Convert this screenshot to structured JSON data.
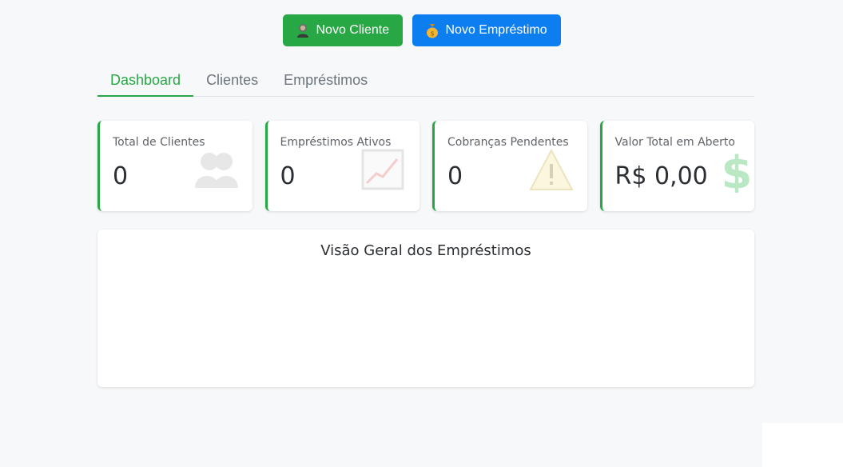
{
  "actions": {
    "new_client_label": "Novo Cliente",
    "new_loan_label": "Novo Empréstimo",
    "new_client_icon": "person-icon",
    "new_loan_icon": "money-bag-icon"
  },
  "tabs": [
    {
      "label": "Dashboard",
      "active": true
    },
    {
      "label": "Clientes",
      "active": false
    },
    {
      "label": "Empréstimos",
      "active": false
    }
  ],
  "cards": [
    {
      "title": "Total de Clientes",
      "value": "0",
      "icon": "people-icon"
    },
    {
      "title": "Empréstimos Ativos",
      "value": "0",
      "icon": "chart-up-icon"
    },
    {
      "title": "Cobranças Pendentes",
      "value": "0",
      "icon": "warning-icon"
    },
    {
      "title": "Valor Total em Aberto",
      "value": "R$ 0,00",
      "icon": "dollar-icon"
    }
  ],
  "overview": {
    "title": "Visão Geral dos Empréstimos"
  },
  "colors": {
    "primary_green": "#28a745",
    "primary_blue": "#0d7ef0",
    "background": "#f7f8fa"
  }
}
